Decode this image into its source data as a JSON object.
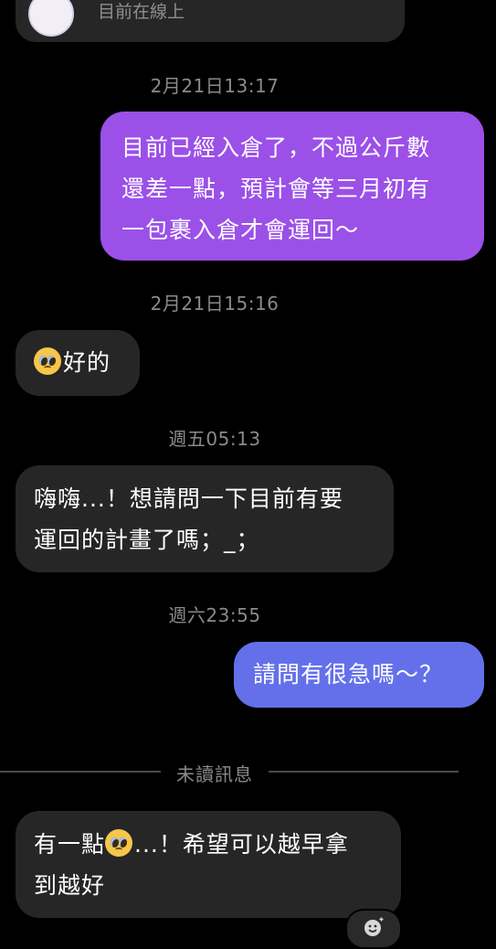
{
  "header": {
    "status_text": "目前在線上"
  },
  "messages": {
    "ts1": "2月21日13:17",
    "out1_line1": "目前已經入倉了，不過公斤數",
    "out1_line2": "還差一點，預計會等三月初有",
    "out1_line3": "一包裹入倉才會運回～",
    "ts2": "2月21日15:16",
    "in1_text": "好的",
    "ts3": "週五05:13",
    "in2_line1": "嗨嗨...！想請問一下目前有要",
    "in2_line2": "運回的計畫了嗎；_；",
    "ts4": "週六23:55",
    "out2_text": "請問有很急嗎～？",
    "unread_label": "未讀訊息",
    "in3_line1_a": "有一點",
    "in3_line1_b": "...！希望可以越早拿",
    "in3_line2": "到越好"
  },
  "icons": {
    "emoji": "pleading-face-icon",
    "react": "add-reaction-icon"
  },
  "colors": {
    "background": "#000000",
    "incoming_bubble": "#262626",
    "outgoing_bubble_purple": "#9b50e8",
    "outgoing_bubble_blue": "#6470ea",
    "timestamp": "#8a8a8a"
  }
}
